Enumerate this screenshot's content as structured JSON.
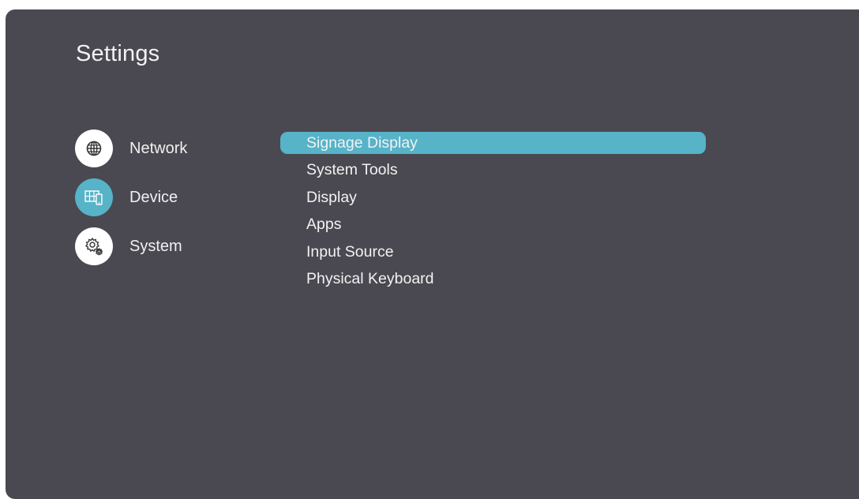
{
  "page": {
    "title": "Settings"
  },
  "categories": [
    {
      "label": "Network",
      "icon": "globe-icon",
      "active": false
    },
    {
      "label": "Device",
      "icon": "device-icon",
      "active": true
    },
    {
      "label": "System",
      "icon": "gear-icon",
      "active": false
    }
  ],
  "submenu": {
    "selected": "Signage Display",
    "items": [
      {
        "label": "Signage Display"
      },
      {
        "label": "System Tools"
      },
      {
        "label": "Display"
      },
      {
        "label": "Apps"
      },
      {
        "label": "Input Source"
      },
      {
        "label": "Physical Keyboard"
      }
    ]
  },
  "colors": {
    "panel_background": "#4a4951",
    "accent": "#56b3c8",
    "text": "#f2f2f2",
    "icon_circle": "#ffffff"
  }
}
